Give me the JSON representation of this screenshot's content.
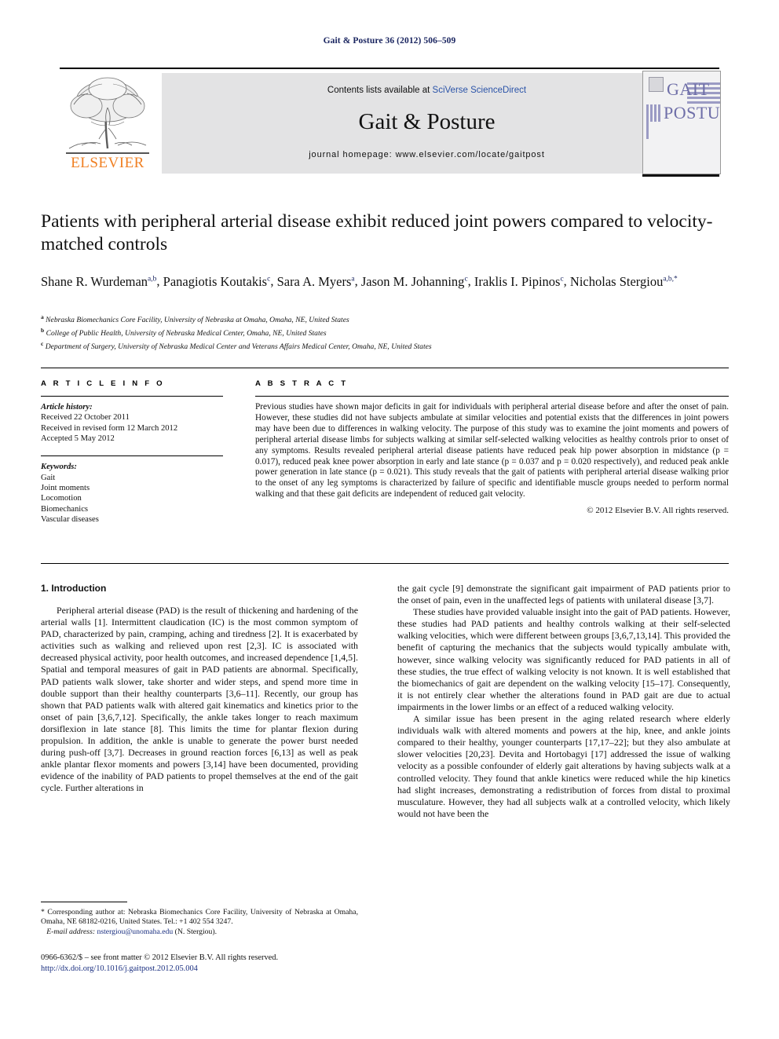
{
  "running_head": "Gait & Posture 36 (2012) 506–509",
  "masthead": {
    "contents_prefix": "Contents lists available at ",
    "sciencedirect": "SciVerse ScienceDirect",
    "journal_title": "Gait & Posture",
    "homepage_label": "journal homepage: www.elsevier.com/locate/gaitpost",
    "publisher_wordmark": "ELSEVIER",
    "cover_line1": "GAIT",
    "cover_line2": "POSTURE"
  },
  "article": {
    "title": "Patients with peripheral arterial disease exhibit reduced joint powers compared to velocity-matched controls",
    "authors_line1_parts": [
      {
        "name": "Shane R. Wurdeman",
        "sup": "a,b"
      },
      {
        "name": "Panagiotis Koutakis",
        "sup": "c"
      },
      {
        "name": "Sara A. Myers",
        "sup": "a"
      },
      {
        "name": "Jason M. Johanning",
        "sup": "c"
      },
      {
        "name": "Iraklis I. Pipinos",
        "sup": "c"
      },
      {
        "name": "Nicholas Stergiou",
        "sup": "a,b,*"
      }
    ],
    "affiliations": [
      {
        "mark": "a",
        "text": "Nebraska Biomechanics Core Facility, University of Nebraska at Omaha, Omaha, NE, United States"
      },
      {
        "mark": "b",
        "text": "College of Public Health, University of Nebraska Medical Center, Omaha, NE, United States"
      },
      {
        "mark": "c",
        "text": "Department of Surgery, University of Nebraska Medical Center and Veterans Affairs Medical Center, Omaha, NE, United States"
      }
    ]
  },
  "article_info": {
    "heading": "A R T I C L E   I N F O",
    "history_label": "Article history:",
    "history": [
      "Received 22 October 2011",
      "Received in revised form 12 March 2012",
      "Accepted 5 May 2012"
    ],
    "keywords_label": "Keywords:",
    "keywords": [
      "Gait",
      "Joint moments",
      "Locomotion",
      "Biomechanics",
      "Vascular diseases"
    ]
  },
  "abstract": {
    "heading": "A B S T R A C T",
    "text": "Previous studies have shown major deficits in gait for individuals with peripheral arterial disease before and after the onset of pain. However, these studies did not have subjects ambulate at similar velocities and potential exists that the differences in joint powers may have been due to differences in walking velocity. The purpose of this study was to examine the joint moments and powers of peripheral arterial disease limbs for subjects walking at similar self-selected walking velocities as healthy controls prior to onset of any symptoms. Results revealed peripheral arterial disease patients have reduced peak hip power absorption in midstance (p = 0.017), reduced peak knee power absorption in early and late stance (p = 0.037 and p = 0.020 respectively), and reduced peak ankle power generation in late stance (p = 0.021). This study reveals that the gait of patients with peripheral arterial disease walking prior to the onset of any leg symptoms is characterized by failure of specific and identifiable muscle groups needed to perform normal walking and that these gait deficits are independent of reduced gait velocity.",
    "copyright": "© 2012 Elsevier B.V. All rights reserved."
  },
  "introduction": {
    "heading": "1. Introduction",
    "left_paragraph_1": "Peripheral arterial disease (PAD) is the result of thickening and hardening of the arterial walls [1]. Intermittent claudication (IC) is the most common symptom of PAD, characterized by pain, cramping, aching and tiredness [2]. It is exacerbated by activities such as walking and relieved upon rest [2,3]. IC is associated with decreased physical activity, poor health outcomes, and increased dependence [1,4,5]. Spatial and temporal measures of gait in PAD patients are abnormal. Specifically, PAD patients walk slower, take shorter and wider steps, and spend more time in double support than their healthy counterparts [3,6–11]. Recently, our group has shown that PAD patients walk with altered gait kinematics and kinetics prior to the onset of pain [3,6,7,12]. Specifically, the ankle takes longer to reach maximum dorsiflexion in late stance [8]. This limits the time for plantar flexion during propulsion. In addition, the ankle is unable to generate the power burst needed during push-off [3,7]. Decreases in ground reaction forces [6,13] as well as peak ankle plantar flexor moments and powers [3,14] have been documented, providing evidence of the inability of PAD patients to propel themselves at the end of the gait cycle. Further alterations in",
    "right_paragraph_1": "the gait cycle [9] demonstrate the significant gait impairment of PAD patients prior to the onset of pain, even in the unaffected legs of patients with unilateral disease [3,7].",
    "right_paragraph_2": "These studies have provided valuable insight into the gait of PAD patients. However, these studies had PAD patients and healthy controls walking at their self-selected walking velocities, which were different between groups [3,6,7,13,14]. This provided the benefit of capturing the mechanics that the subjects would typically ambulate with, however, since walking velocity was significantly reduced for PAD patients in all of these studies, the true effect of walking velocity is not known. It is well established that the biomechanics of gait are dependent on the walking velocity [15–17]. Consequently, it is not entirely clear whether the alterations found in PAD gait are due to actual impairments in the lower limbs or an effect of a reduced walking velocity.",
    "right_paragraph_3": "A similar issue has been present in the aging related research where elderly individuals walk with altered moments and powers at the hip, knee, and ankle joints compared to their healthy, younger counterparts [17,17–22]; but they also ambulate at slower velocities [20,23]. Devita and Hortobagyi [17] addressed the issue of walking velocity as a possible confounder of elderly gait alterations by having subjects walk at a controlled velocity. They found that ankle kinetics were reduced while the hip kinetics had slight increases, demonstrating a redistribution of forces from distal to proximal musculature. However, they had all subjects walk at a controlled velocity, which likely would not have been the"
  },
  "footnote": {
    "marker": "*",
    "corresponding": "Corresponding author at: Nebraska Biomechanics Core Facility, University of Nebraska at Omaha, Omaha, NE 68182-0216, United States. Tel.: +1 402 554 3247.",
    "email_label": "E-mail address:",
    "email": "nstergiou@unomaha.edu",
    "email_owner": "(N. Stergiou)."
  },
  "imprint": {
    "line1": "0966-6362/$ – see front matter © 2012 Elsevier B.V. All rights reserved.",
    "doi": "http://dx.doi.org/10.1016/j.gaitpost.2012.05.004"
  },
  "colors": {
    "link": "#1a2f80",
    "elsevier_orange": "#f08023",
    "band_gray": "#e3e3e4",
    "cover_purple": "#6f6fa8"
  }
}
